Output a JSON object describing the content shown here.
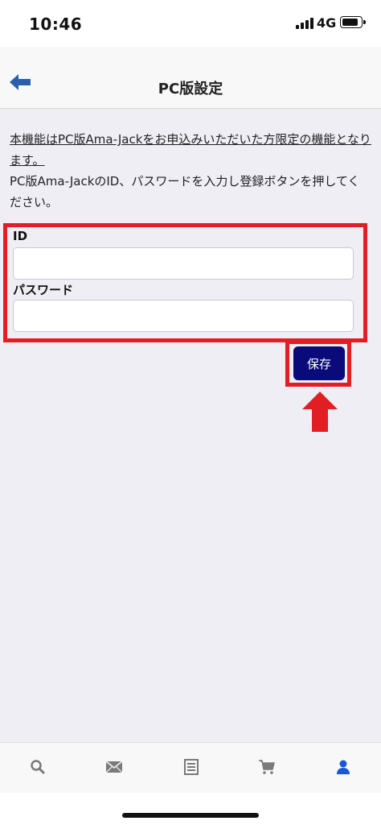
{
  "status_bar": {
    "time": "10:46",
    "network": "4G"
  },
  "nav": {
    "title": "PC版設定"
  },
  "notice": {
    "underlined": "本機能はPC版Ama-Jackをお申込みいただいた方限定の機能となります。",
    "body": "PC版Ama-JackのID、パスワードを入力し登録ボタンを押してください。"
  },
  "form": {
    "id_label": "ID",
    "id_value": "",
    "password_label": "パスワード",
    "password_value": "",
    "save_label": "保存"
  },
  "tabs": [
    {
      "icon": "search-icon"
    },
    {
      "icon": "mail-icon"
    },
    {
      "icon": "list-icon"
    },
    {
      "icon": "cart-icon"
    },
    {
      "icon": "user-icon",
      "active": true
    }
  ],
  "colors": {
    "accent": "#1a57d6",
    "highlight": "#e01e24",
    "save_button": "#0a0a7a"
  }
}
